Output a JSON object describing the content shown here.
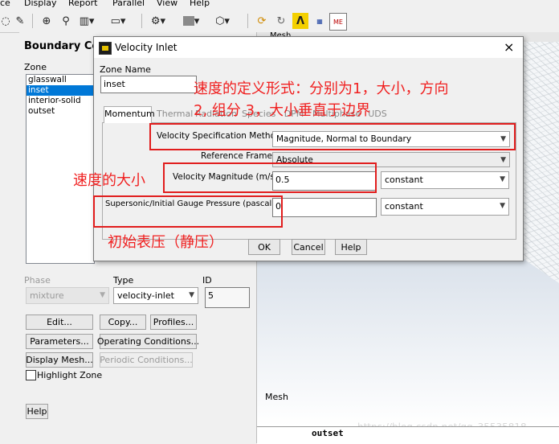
{
  "menubar": [
    "ce",
    "Display",
    "Report",
    "Parallel",
    "View",
    "Help"
  ],
  "toolbar_icons": [
    "cursor-icon",
    "zoom-icon",
    "probe-icon",
    "layout-icon",
    "window-icon",
    "ruler-icon",
    "color-icon",
    "cube-icon",
    "rotate-icon",
    "refresh-icon",
    "lambda-icon",
    "grid-icon",
    "me-icon"
  ],
  "bc_panel": {
    "title": "Boundary Co",
    "zone_label": "Zone",
    "zones": [
      "glasswall",
      "inset",
      "interior-solid",
      "outset"
    ],
    "selected_zone": "inset",
    "phase_label": "Phase",
    "phase_value": "mixture",
    "type_label": "Type",
    "type_value": "velocity-inlet",
    "id_label": "ID",
    "id_value": "5",
    "buttons": {
      "edit": "Edit...",
      "copy": "Copy...",
      "profiles": "Profiles...",
      "parameters": "Parameters...",
      "operating": "Operating Conditions...",
      "display_mesh": "Display Mesh...",
      "periodic": "Periodic Conditions..."
    },
    "highlight_zone": "Highlight Zone",
    "help": "Help"
  },
  "graphics": {
    "header_text": "Mesh",
    "mesh_label": "Mesh",
    "bottom_label": "outset",
    "watermark": "https://blog.csdn.net/qq_35535818"
  },
  "dialog": {
    "title": "Velocity Inlet",
    "close": "×",
    "zone_name_label": "Zone Name",
    "zone_name_value": "inset",
    "tabs": [
      "Momentum",
      "Thermal",
      "Radiation",
      "Species",
      "DPM",
      "Multiphase",
      "UDS"
    ],
    "active_tab": "Momentum",
    "velocity_spec_label": "Velocity Specification Method",
    "velocity_spec_value": "Magnitude, Normal to Boundary",
    "reference_frame_label": "Reference Frame",
    "reference_frame_value": "Absolute",
    "velocity_mag_label": "Velocity Magnitude (m/s)",
    "velocity_mag_value": "0.5",
    "velocity_mag_method": "constant",
    "gauge_label": "Supersonic/Initial Gauge Pressure (pascal)",
    "gauge_value": "0",
    "gauge_method": "constant",
    "ok": "OK",
    "cancel": "Cancel",
    "help": "Help"
  },
  "annotations": {
    "velocity_form_line1": "速度的定义形式：分别为1，大小，方向",
    "velocity_form_line2": "2, 组分 3，大小垂直于边界",
    "velocity_size": "速度的大小",
    "initial_pressure": "初始表压（静压）",
    "color": "#f02020"
  }
}
